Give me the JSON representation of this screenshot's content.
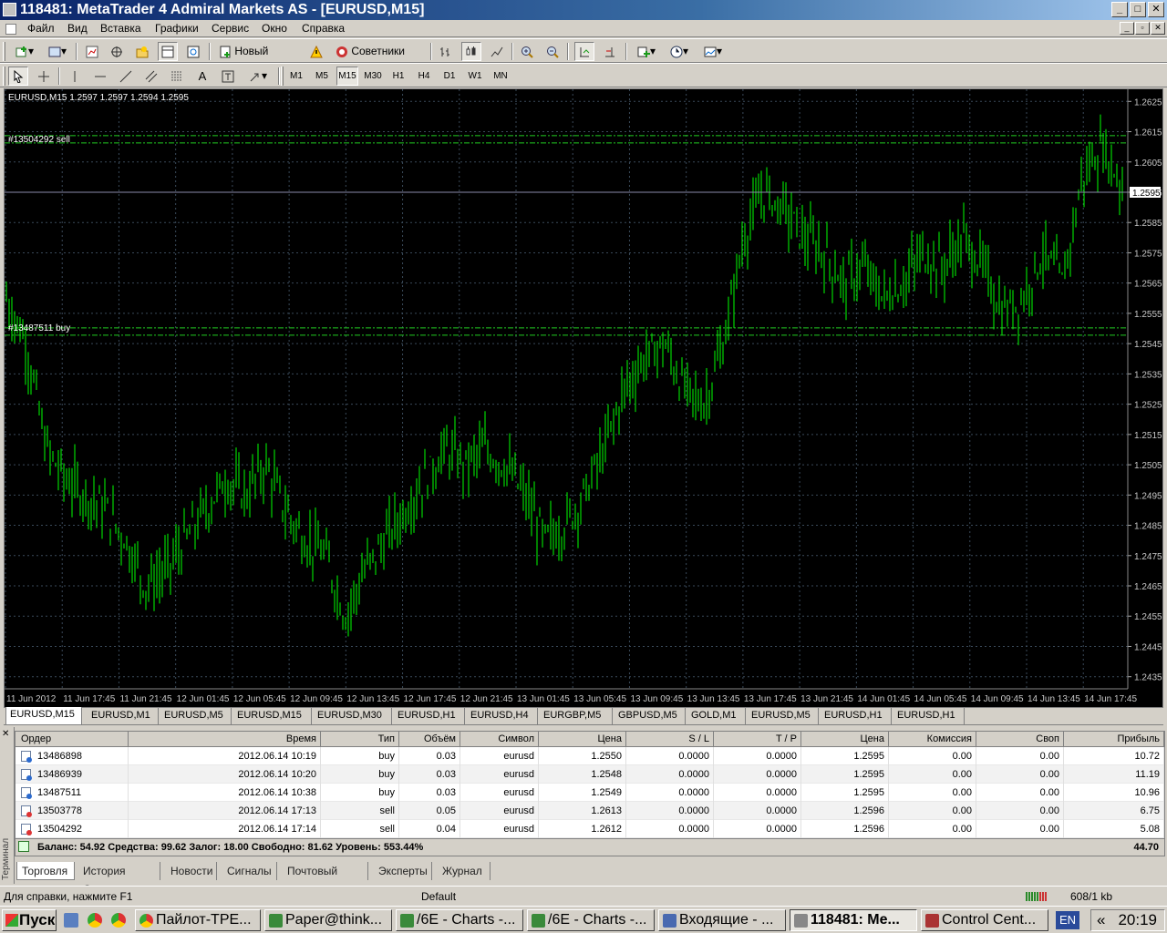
{
  "window": {
    "title": "118481: MetaTrader 4 Admiral Markets AS - [EURUSD,M15]"
  },
  "menu": [
    "Файл",
    "Вид",
    "Вставка",
    "Графики",
    "Сервис",
    "Окно",
    "Справка"
  ],
  "toolbar": {
    "new_order": "Новый Ордер",
    "experts": "Советники"
  },
  "periods": [
    "M1",
    "M5",
    "M15",
    "M30",
    "H1",
    "H4",
    "D1",
    "W1",
    "MN"
  ],
  "active_period": "M15",
  "chart": {
    "header": "EURUSD,M15  1.2597 1.2597 1.2594 1.2595",
    "sell_label": "#13504292 sell",
    "buy_label": "#13487511 buy",
    "current_price": "1.2595",
    "colors": {
      "background": "#000000",
      "bars": "#00ff00",
      "grid": "#3a4a5a",
      "price_line": "#8a8aaa"
    }
  },
  "chart_data": {
    "type": "line",
    "title": "EURUSD,M15",
    "x_ticks": [
      "11 Jun 2012",
      "11 Jun 17:45",
      "11 Jun 21:45",
      "12 Jun 01:45",
      "12 Jun 05:45",
      "12 Jun 09:45",
      "12 Jun 13:45",
      "12 Jun 17:45",
      "12 Jun 21:45",
      "13 Jun 01:45",
      "13 Jun 05:45",
      "13 Jun 09:45",
      "13 Jun 13:45",
      "13 Jun 17:45",
      "13 Jun 21:45",
      "14 Jun 01:45",
      "14 Jun 05:45",
      "14 Jun 09:45",
      "14 Jun 13:45",
      "14 Jun 17:45"
    ],
    "y_ticks": [
      "1.2625",
      "1.2615",
      "1.2605",
      "1.2595",
      "1.2585",
      "1.2575",
      "1.2565",
      "1.2555",
      "1.2545",
      "1.2535",
      "1.2525",
      "1.2515",
      "1.2505",
      "1.2495",
      "1.2485",
      "1.2475",
      "1.2465",
      "1.2455",
      "1.2445",
      "1.2435"
    ],
    "ylim": [
      1.2431,
      1.2629
    ],
    "series": [
      {
        "values": [
          1.256,
          1.2545,
          1.251,
          1.25,
          1.2495,
          1.249,
          1.248,
          1.2465,
          1.247,
          1.248,
          1.249,
          1.25,
          1.2495,
          1.2505,
          1.249,
          1.248,
          1.2475,
          1.2455,
          1.247,
          1.248,
          1.249,
          1.25,
          1.251,
          1.2505,
          1.251,
          1.2505,
          1.2495,
          1.248,
          1.2485,
          1.2495,
          1.251,
          1.253,
          1.254,
          1.2545,
          1.253,
          1.2525,
          1.2545,
          1.258,
          1.2595,
          1.259,
          1.258,
          1.2575,
          1.2565,
          1.257,
          1.256,
          1.2565,
          1.2575,
          1.257,
          1.258,
          1.257,
          1.2555,
          1.256,
          1.2575,
          1.2565,
          1.26,
          1.261,
          1.2597
        ]
      }
    ]
  },
  "chart_tabs": [
    "EURUSD,M15",
    "EURUSD,M1",
    "EURUSD,M5",
    "EURUSD,M15",
    "EURUSD,M30",
    "EURUSD,H1",
    "EURUSD,H4",
    "EURGBP,M5",
    "GBPUSD,M5",
    "GOLD,M1",
    "EURUSD,M5",
    "EURUSD,H1",
    "EURUSD,H1"
  ],
  "terminal": {
    "side_label": "Терминал",
    "columns": [
      "Ордер",
      "Время",
      "Тип",
      "Объём",
      "Символ",
      "Цена",
      "S / L",
      "T / P",
      "Цена",
      "Комиссия",
      "Своп",
      "Прибыль"
    ],
    "rows": [
      {
        "order": "13486898",
        "time": "2012.06.14 10:19",
        "type": "buy",
        "volume": "0.03",
        "symbol": "eurusd",
        "price": "1.2550",
        "sl": "0.0000",
        "tp": "0.0000",
        "cur": "1.2595",
        "commission": "0.00",
        "swap": "0.00",
        "profit": "10.72"
      },
      {
        "order": "13486939",
        "time": "2012.06.14 10:20",
        "type": "buy",
        "volume": "0.03",
        "symbol": "eurusd",
        "price": "1.2548",
        "sl": "0.0000",
        "tp": "0.0000",
        "cur": "1.2595",
        "commission": "0.00",
        "swap": "0.00",
        "profit": "11.19"
      },
      {
        "order": "13487511",
        "time": "2012.06.14 10:38",
        "type": "buy",
        "volume": "0.03",
        "symbol": "eurusd",
        "price": "1.2549",
        "sl": "0.0000",
        "tp": "0.0000",
        "cur": "1.2595",
        "commission": "0.00",
        "swap": "0.00",
        "profit": "10.96"
      },
      {
        "order": "13503778",
        "time": "2012.06.14 17:13",
        "type": "sell",
        "volume": "0.05",
        "symbol": "eurusd",
        "price": "1.2613",
        "sl": "0.0000",
        "tp": "0.0000",
        "cur": "1.2596",
        "commission": "0.00",
        "swap": "0.00",
        "profit": "6.75"
      },
      {
        "order": "13504292",
        "time": "2012.06.14 17:14",
        "type": "sell",
        "volume": "0.04",
        "symbol": "eurusd",
        "price": "1.2612",
        "sl": "0.0000",
        "tp": "0.0000",
        "cur": "1.2596",
        "commission": "0.00",
        "swap": "0.00",
        "profit": "5.08"
      }
    ],
    "balance_line": "Баланс: 54.92  Средства: 99.62  Залог: 18.00  Свободно: 81.62  Уровень: 553.44%",
    "total_profit": "44.70",
    "tabs": [
      "Торговля",
      "История Счета",
      "Новости",
      "Сигналы",
      "Почтовый ящик",
      "Эксперты",
      "Журнал"
    ]
  },
  "status": {
    "help": "Для справки, нажмите F1",
    "profile": "Default",
    "traffic": "608/1 kb"
  },
  "taskbar": {
    "start": "Пуск",
    "tasks": [
      "Пайлот-TPE...",
      "Paper@think...",
      "/6E - Charts -...",
      "/6E - Charts -...",
      "Входящие - ...",
      "118481: Me...",
      "Control Cent..."
    ],
    "lang": "EN",
    "tray_arrow": "«",
    "clock": "20:19"
  }
}
